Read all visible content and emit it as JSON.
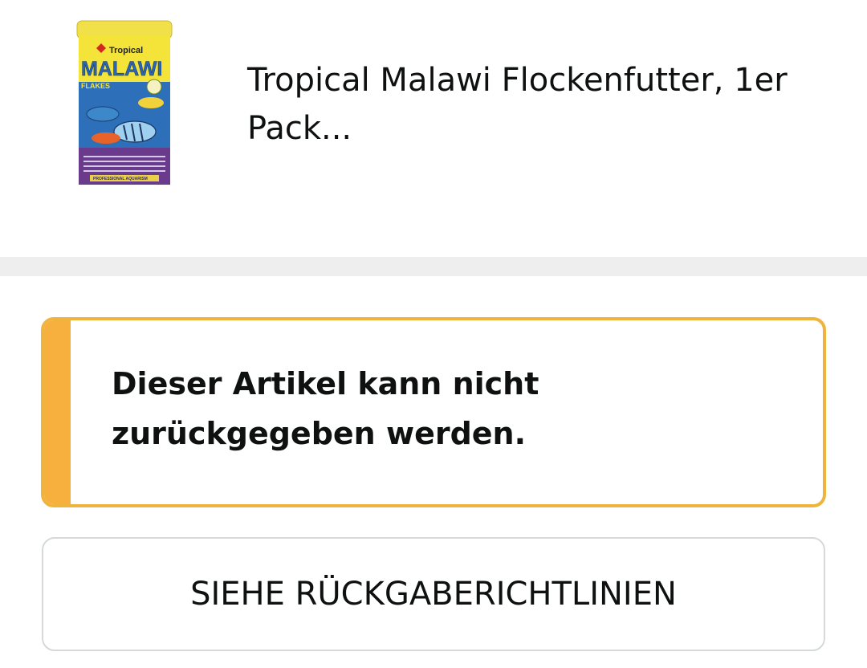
{
  "product": {
    "title": "Tropical Malawi Flockenfutter, 1er Pack...",
    "image": {
      "brand_text": "Tropical",
      "name_text": "MALAWI",
      "sub_text": "FLAKES",
      "footer_text": "PROFESSIONAL AQUARISM"
    }
  },
  "alert": {
    "message": "Dieser Artikel kann nicht zurückgegeben werden.",
    "accent_color": "#f7b03e"
  },
  "policy_button": {
    "label": "SIEHE RÜCKGABERICHTLINIEN"
  }
}
